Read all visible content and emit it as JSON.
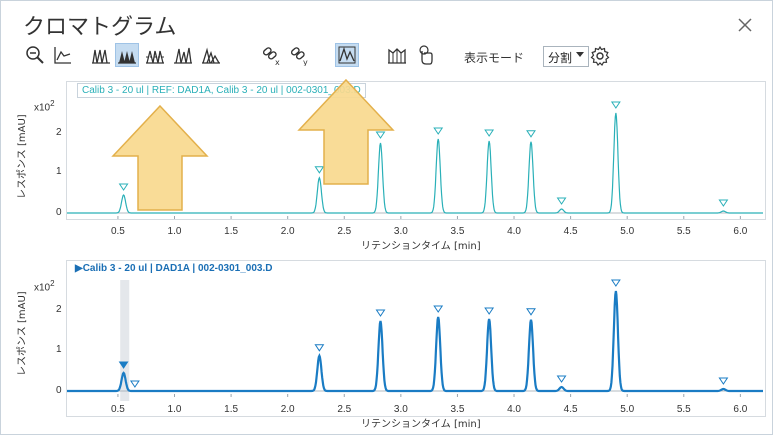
{
  "window": {
    "title": "クロマトグラム"
  },
  "toolbar": {
    "icons": [
      "zoom-out-icon",
      "baseline-icon",
      "overlay-peaks-icon",
      "peaks-filled-icon",
      "peaks-outline-icon",
      "stacked-peaks-icon",
      "staggered-peaks-icon",
      "link-x-icon",
      "link-y-icon",
      "peak-select-icon",
      "integration-icon",
      "touch-icon"
    ],
    "mode_label": "表示モード",
    "mode_value": "分割"
  },
  "panel1": {
    "title": "Calib 3 - 20 ul | REF: DAD1A, Calib 3 - 20 ul | 002-0301_003.D",
    "color": "#2ab0b8",
    "y_label": "レスポンス [mAU]",
    "y_exp": "x10",
    "y_exp_power": "2",
    "y_ticks": [
      "2",
      "1",
      "0"
    ],
    "x_label": "リテンションタイム [min]"
  },
  "panel2": {
    "title": "Calib 3 - 20 ul | DAD1A | 002-0301_003.D",
    "color": "#1a7cc4",
    "y_label": "レスポンス [mAU]",
    "y_exp": "x10",
    "y_exp_power": "2",
    "y_ticks": [
      "2",
      "1",
      "0"
    ],
    "x_label": "リテンションタイム [min]"
  },
  "x_ticks": [
    "0.5",
    "1.0",
    "1.5",
    "2.0",
    "2.5",
    "3.0",
    "3.5",
    "4.0",
    "4.5",
    "5.0",
    "5.5",
    "6.0"
  ],
  "chart_data": {
    "type": "line",
    "xlim": [
      0.05,
      6.2
    ],
    "ylim": [
      -0.1,
      2.6
    ],
    "peaks": [
      {
        "rt": 0.55,
        "height": 0.45
      },
      {
        "rt": 2.28,
        "height": 0.88
      },
      {
        "rt": 2.82,
        "height": 1.75
      },
      {
        "rt": 3.33,
        "height": 1.85
      },
      {
        "rt": 3.78,
        "height": 1.8
      },
      {
        "rt": 4.15,
        "height": 1.78
      },
      {
        "rt": 4.42,
        "height": 0.1
      },
      {
        "rt": 4.9,
        "height": 2.5
      },
      {
        "rt": 5.85,
        "height": 0.05
      }
    ],
    "panel2_extra_marker_rt": 0.65,
    "highlight_range": [
      0.52,
      0.6
    ]
  }
}
